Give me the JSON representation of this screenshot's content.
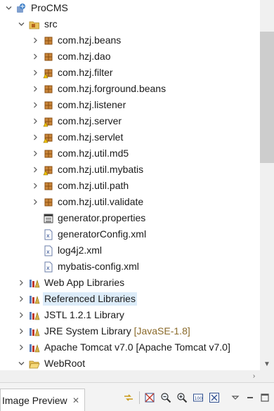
{
  "tree": {
    "project": "ProCMS",
    "src": "src",
    "packages": [
      "com.hzj.beans",
      "com.hzj.dao",
      "com.hzj.filter",
      "com.hzj.forground.beans",
      "com.hzj.listener",
      "com.hzj.server",
      "com.hzj.servlet",
      "com.hzj.util.md5",
      "com.hzj.util.mybatis",
      "com.hzj.util.path",
      "com.hzj.util.validate"
    ],
    "files": [
      "generator.properties",
      "generatorConfig.xml",
      "log4j2.xml",
      "mybatis-config.xml"
    ],
    "libraries": {
      "web_app": "Web App Libraries",
      "referenced": "Referenced Libraries",
      "jstl": "JSTL 1.2.1 Library",
      "jre": "JRE System Library",
      "jre_decoration": "[JavaSE-1.8]",
      "tomcat": "Apache Tomcat v7.0 [Apache Tomcat v7.0]"
    },
    "webroot": "WebRoot"
  },
  "panel": {
    "tab_label": "Image Preview",
    "close_glyph": "✕"
  },
  "colors": {
    "selection": "#dcecf9",
    "package_icon": "#b5651d",
    "folder_icon": "#e8c15a",
    "decoration_text": "#8a6a2a"
  }
}
